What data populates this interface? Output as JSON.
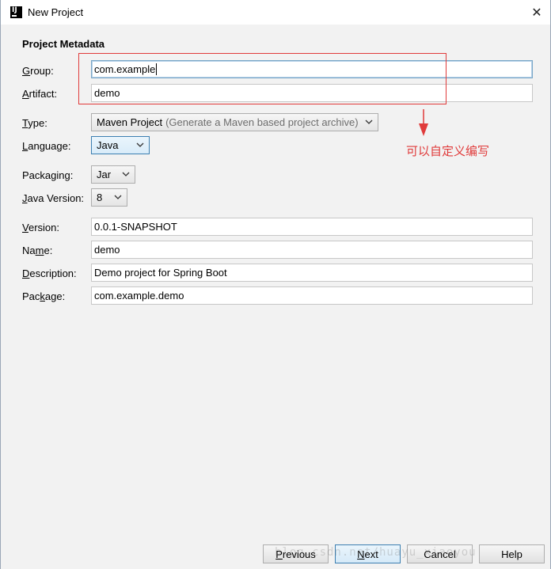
{
  "window": {
    "title": "New Project",
    "close_glyph": "✕",
    "icon": "intellij-icon",
    "icon_letters": "IJ"
  },
  "section": {
    "title": "Project Metadata"
  },
  "fields": {
    "group": {
      "label_u": "G",
      "label_rest": "roup:",
      "value": "com.example"
    },
    "artifact": {
      "label_u": "A",
      "label_rest": "rtifact:",
      "value": "demo"
    },
    "type": {
      "label_u": "T",
      "label_rest": "ype:",
      "value": "Maven Project",
      "hint": "(Generate a Maven based project archive)"
    },
    "language": {
      "label_u": "L",
      "label_rest": "anguage:",
      "value": "Java"
    },
    "packaging": {
      "label_pre": "Packa",
      "label_u": "g",
      "label_rest": "ing:",
      "value": "Jar"
    },
    "java_version": {
      "label_u": "J",
      "label_rest": "ava Version:",
      "value": "8"
    },
    "version": {
      "label_u": "V",
      "label_rest": "ersion:",
      "value": "0.0.1-SNAPSHOT"
    },
    "name": {
      "label_pre": "Na",
      "label_u": "m",
      "label_rest": "e:",
      "value": "demo"
    },
    "description": {
      "label_u": "D",
      "label_rest": "escription:",
      "value": "Demo project for Spring Boot"
    },
    "package": {
      "label_pre": "Pac",
      "label_u": "k",
      "label_rest": "age:",
      "value": "com.example.demo"
    }
  },
  "annotation": {
    "text": "可以自定义编写",
    "color": "#e03b3b"
  },
  "buttons": {
    "previous": {
      "u": "P",
      "rest": "revious"
    },
    "next": {
      "u": "N",
      "rest": "ext"
    },
    "cancel": {
      "label": "Cancel"
    },
    "help": {
      "label": "Help"
    }
  },
  "watermark": "blog.csdn.net/huayu_xiaoyou",
  "colors": {
    "accent": "#3c7fb1",
    "window_bg": "#f2f2f2"
  }
}
